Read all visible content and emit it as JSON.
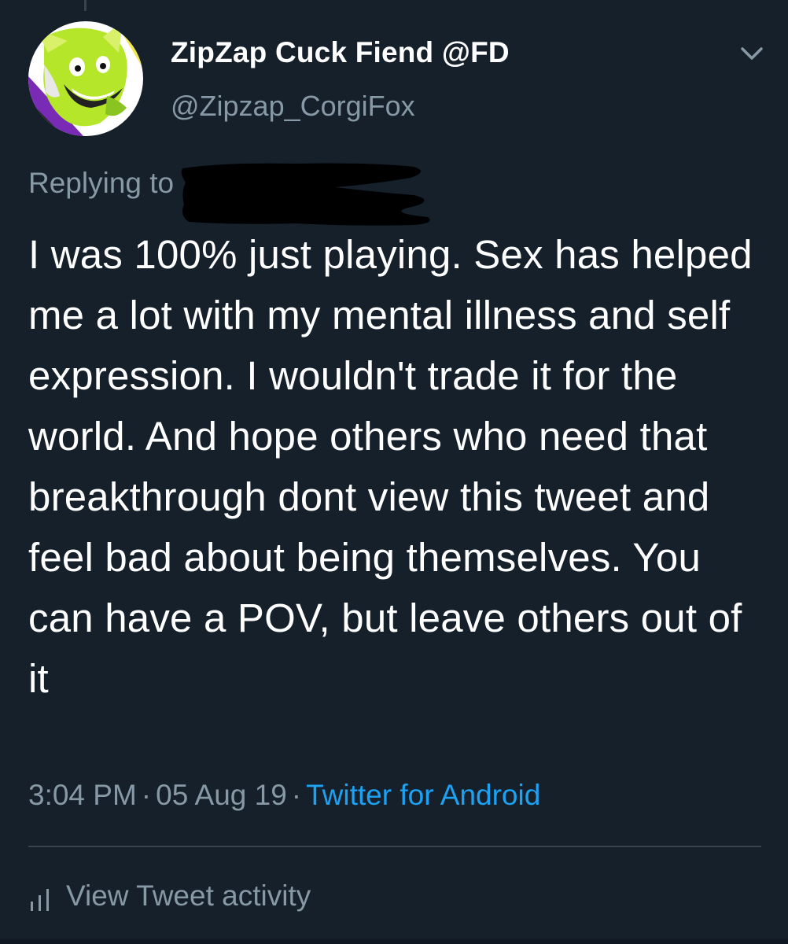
{
  "tweet": {
    "author": {
      "display_name": "ZipZap Cuck Fiend @FD",
      "handle": "@Zipzap_CorgiFox"
    },
    "replying_to_label": "Replying to",
    "text": "I was 100% just playing. Sex has helped me a lot with my mental illness and self expression. I wouldn't trade it for the world. And hope others who need that breakthrough dont view this tweet and feel bad about being themselves. You can have a POV, but leave others out of it",
    "time": "3:04 PM",
    "date": "05 Aug 19",
    "separator": "·",
    "source": "Twitter for Android",
    "activity_label": "View Tweet activity"
  },
  "icons": {
    "menu": "chevron-down-icon",
    "activity": "bar-chart-icon"
  },
  "colors": {
    "background": "#15202b",
    "text": "#ffffff",
    "secondary_text": "#8899a6",
    "link": "#1da1f2",
    "divider": "#38444d",
    "redaction": "#000000"
  }
}
